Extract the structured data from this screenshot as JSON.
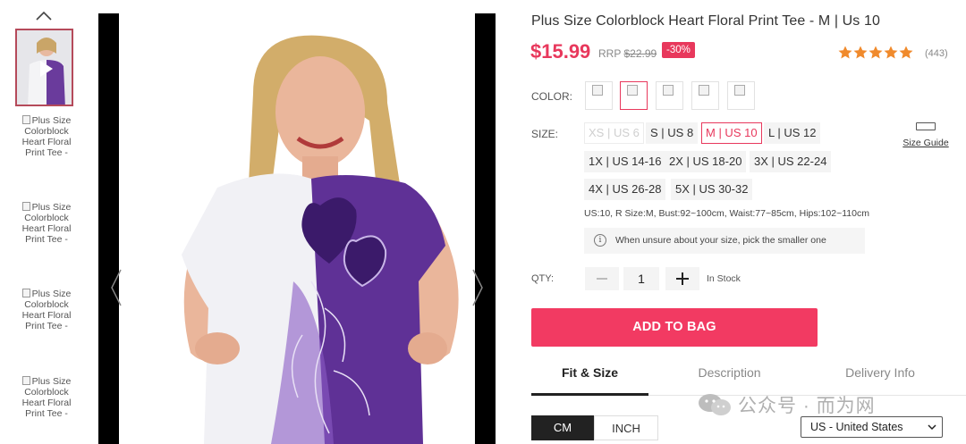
{
  "thumbnails": {
    "alt_text": "Plus Size Colorblock Heart Floral Print Tee -",
    "items": [
      "Plus Size Colorblock Heart Floral Print Tee -",
      "Plus Size Colorblock Heart Floral Print Tee -",
      "Plus Size Colorblock Heart Floral Print Tee -",
      "Plus Size Colorblock Heart Floral Print Tee -"
    ]
  },
  "product": {
    "title": "Plus Size Colorblock Heart Floral Print Tee - M | Us 10",
    "price": "$15.99",
    "rrp_label": "RRP",
    "rrp_value": "$22.99",
    "discount": "-30%",
    "rating": 5,
    "reviews": "(443)",
    "accent_color": "#e8385c"
  },
  "color": {
    "label": "COLOR:",
    "swatch_count": 5,
    "selected_index": 1
  },
  "size": {
    "label": "SIZE:",
    "options": [
      "XS | US 6",
      "S | US 8",
      "M | US 10",
      "L | US 12",
      "1X | US 14-16",
      "2X | US 18-20",
      "3X | US 22-24",
      "4X | US 26-28",
      "5X | US 30-32"
    ],
    "selected": "M | US 10",
    "disabled": [
      "XS | US 6"
    ],
    "guide_label": "Size Guide",
    "measurements": "US:10, R Size:M, Bust:92~100cm, Waist:77~85cm, Hips:102~110cm",
    "tip": "When unsure about your size, pick the smaller one"
  },
  "quantity": {
    "label": "QTY:",
    "value": "1",
    "stock": "In Stock"
  },
  "add_to_bag": "ADD TO BAG",
  "tabs": [
    "Fit & Size",
    "Description",
    "Delivery Info"
  ],
  "units": {
    "cm": "CM",
    "inch": "INCH"
  },
  "watermark": "公众号 · 而为网",
  "locale": "US - United States"
}
